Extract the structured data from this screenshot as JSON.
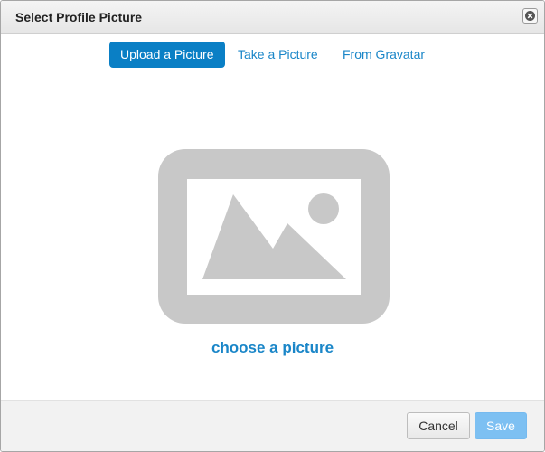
{
  "dialog": {
    "title": "Select Profile Picture",
    "close_icon": "close-icon"
  },
  "tabs": [
    {
      "label": "Upload a Picture",
      "active": true
    },
    {
      "label": "Take a Picture",
      "active": false
    },
    {
      "label": "From Gravatar",
      "active": false
    }
  ],
  "upload": {
    "placeholder_icon": "image-placeholder-icon",
    "choose_label": "choose a picture"
  },
  "footer": {
    "cancel_label": "Cancel",
    "save_label": "Save"
  },
  "colors": {
    "accent": "#0a7fc5",
    "link": "#1a86c8",
    "placeholder_gray": "#c8c8c8",
    "save_disabled": "#7dc0f2"
  }
}
